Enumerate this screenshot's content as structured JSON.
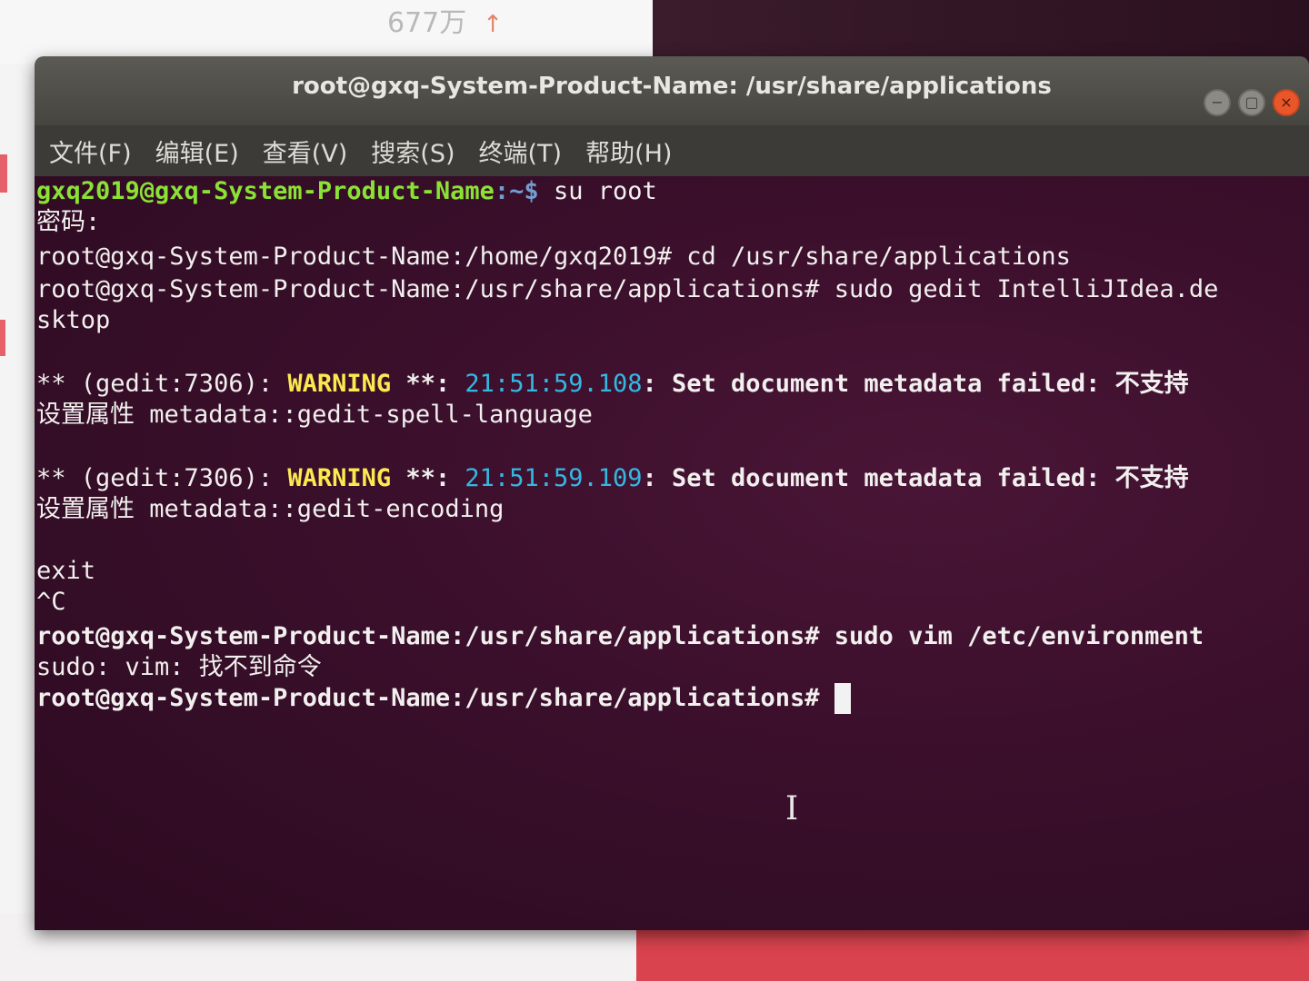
{
  "background": {
    "counter_text": "677万",
    "arrow_glyph": "↑"
  },
  "window": {
    "title": "root@gxq-System-Product-Name: /usr/share/applications",
    "controls": {
      "minimize": "−",
      "maximize": "▢",
      "close": "×"
    }
  },
  "menu": {
    "items": [
      "文件(F)",
      "编辑(E)",
      "查看(V)",
      "搜索(S)",
      "终端(T)",
      "帮助(H)"
    ]
  },
  "terminal": {
    "l1_prompt_user": "gxq2019@gxq-System-Product-Name",
    "l1_prompt_path": ":~$",
    "l1_cmd": " su root",
    "l2": "密码:",
    "l3": "root@gxq-System-Product-Name:/home/gxq2019# cd /usr/share/applications",
    "l4": "root@gxq-System-Product-Name:/usr/share/applications# sudo gedit IntelliJIdea.de",
    "l5": "sktop",
    "w1_prefix": "** (gedit:7306): ",
    "w1_level": "WARNING",
    "w1_mid": " **: ",
    "w1_time": "21:51:59.108",
    "w1_msg": ": Set document metadata failed: 不支持",
    "w1_cont": "设置属性 metadata::gedit-spell-language",
    "w2_prefix": "** (gedit:7306): ",
    "w2_level": "WARNING",
    "w2_mid": " **: ",
    "w2_time": "21:51:59.109",
    "w2_msg": ": Set document metadata failed: 不支持",
    "w2_cont": "设置属性 metadata::gedit-encoding",
    "l_exit": "exit",
    "l_ctrlc": "^C",
    "l_vim": "root@gxq-System-Product-Name:/usr/share/applications# sudo vim /etc/environment",
    "l_err": "sudo: vim: 找不到命令",
    "l_prompt": "root@gxq-System-Product-Name:/usr/share/applications# "
  },
  "colors": {
    "terminal_bg": "#3a0f2b",
    "prompt_green": "#8ae234",
    "warning_yellow": "#fce94f",
    "timestamp_cyan": "#34b8e2"
  }
}
